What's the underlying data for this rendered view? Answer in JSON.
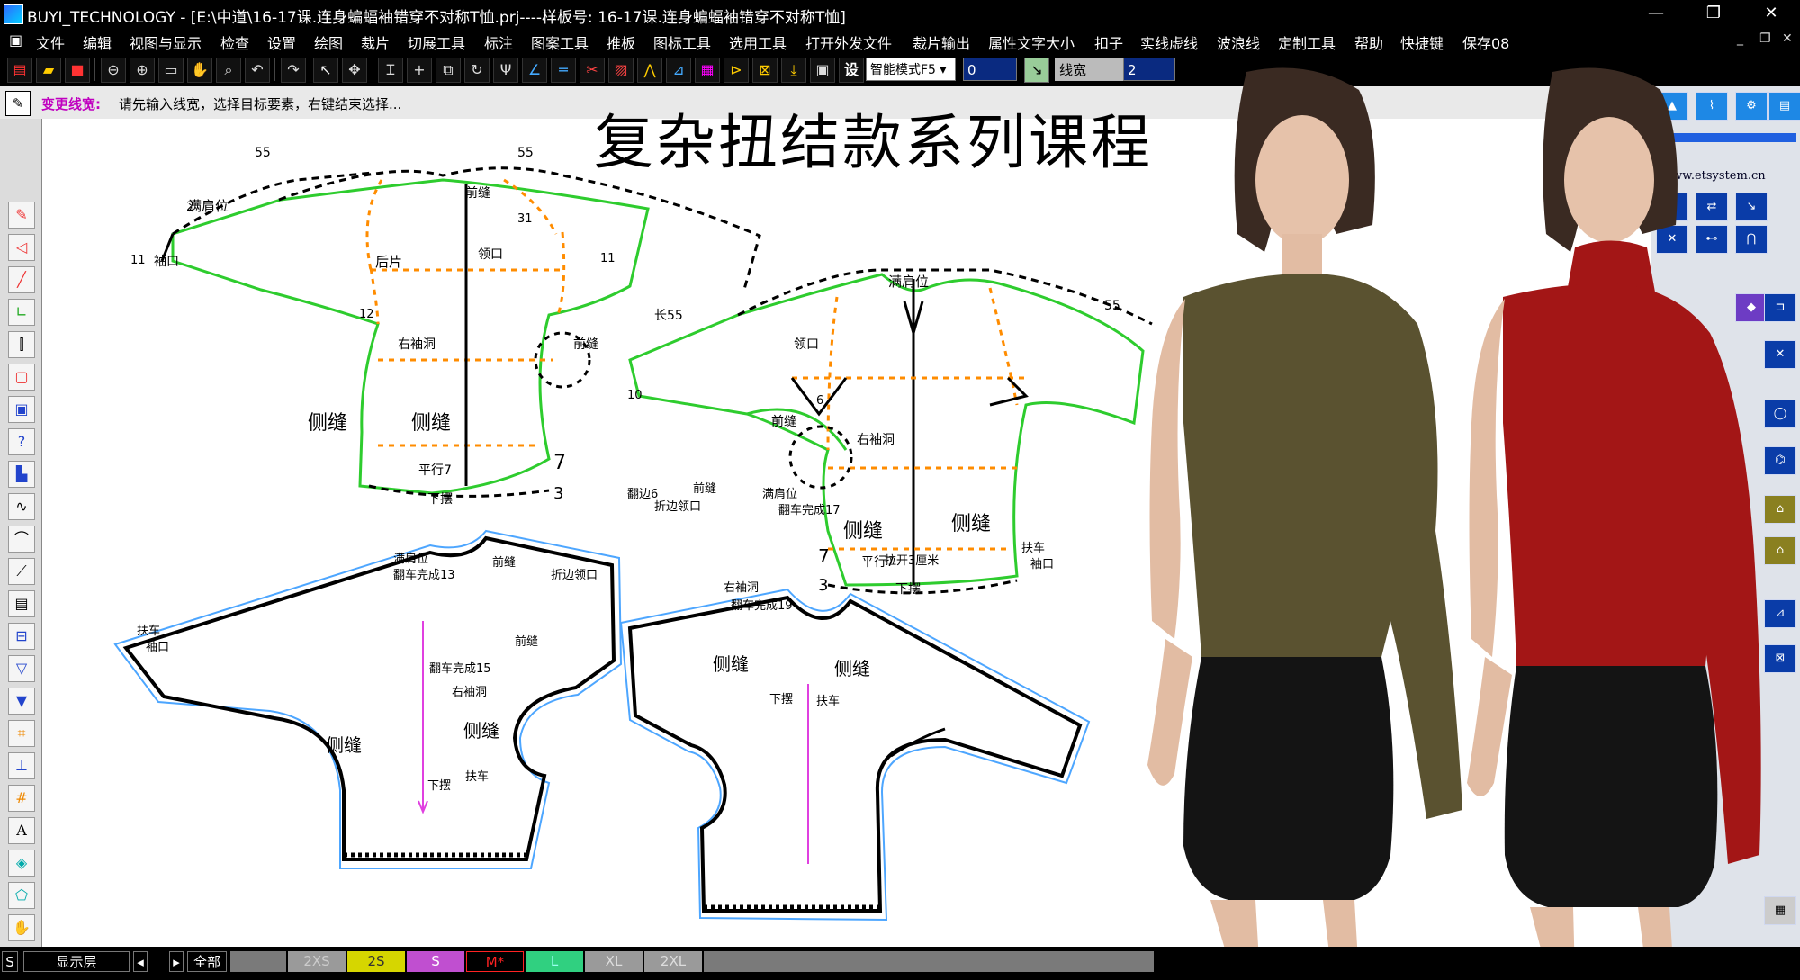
{
  "window": {
    "title": "BUYI_TECHNOLOGY - [E:\\中道\\16-17课.连身蝙蝠袖错穿不对称T恤.prj----样板号: 16-17课.连身蝙蝠袖错穿不对称T恤]",
    "minimize": "—",
    "restore": "❐",
    "close": "✕"
  },
  "menu": {
    "items": [
      "文件",
      "编辑",
      "视图与显示",
      "检查",
      "设置",
      "绘图",
      "裁片",
      "切展工具",
      "标注",
      "图案工具",
      "推板",
      "图标工具",
      "选用工具",
      "打开外发文件",
      "裁片输出",
      "属性文字大小",
      "扣子",
      "实线虚线",
      "波浪线",
      "定制工具",
      "帮助",
      "快捷键",
      "保存08"
    ],
    "sys_minimize": "_",
    "sys_restore": "❐",
    "sys_close": "✕"
  },
  "toolbar": {
    "mode_label": "智能模式F5",
    "value_field": "0",
    "line_width_label": "线宽",
    "line_width_value": "2",
    "set_label": "设"
  },
  "prompt": {
    "command": "变更线宽:",
    "message": "请先输入线宽，选择目标要素，右键结束选择..."
  },
  "canvas": {
    "big_title": "复杂扭结款系列课程",
    "website": "www.etsystem.cn"
  },
  "pattern_labels": {
    "back": "后片",
    "front_label_1": "前缝",
    "front_label_2": "前缝",
    "neck_tag": "满肩位",
    "collar": "领口",
    "cuff_left": "袖口",
    "cuff_right": "袖口",
    "side_seam": "侧缝",
    "right_armhole": "右袖洞",
    "hem": "下摆",
    "parallel": "平行7",
    "sleeve_len": "长55",
    "n55": "55",
    "n2": "2",
    "n3": "3",
    "n7": "7",
    "n12": "12",
    "n11": "11",
    "n10": "10",
    "n31": "31",
    "n6": "6",
    "seam_finish_13": "翻车完成13",
    "seam_finish_15": "翻车完成15",
    "seam_finish_17": "翻车完成17",
    "seam_finish_19": "翻车完成19",
    "hem_seam": "扶车",
    "fold_collar": "折边领口",
    "fold_6": "翻边6",
    "stretch": "拉开3厘米"
  },
  "status": {
    "s": "S",
    "layer": "显示层",
    "all": "全部",
    "sizes": [
      {
        "label": "2XS",
        "color": "#9a9a9a"
      },
      {
        "label": "2S",
        "color": "#d6d600"
      },
      {
        "label": "S",
        "color": "#c04fd0"
      },
      {
        "label": "M*",
        "color": "#ff2020"
      },
      {
        "label": "L",
        "color": "#30d080"
      },
      {
        "label": "XL",
        "color": "#9a9a9a"
      },
      {
        "label": "2XL",
        "color": "#9a9a9a"
      }
    ]
  },
  "colors": {
    "pattern_green": "#2ecc2e",
    "pattern_orange": "#ff8c00",
    "seam_blue": "#4da6ff",
    "grain_magenta": "#e040e0",
    "garment_gold": "#5a5230",
    "garment_red": "#a31616",
    "skirt_black": "#141414"
  }
}
